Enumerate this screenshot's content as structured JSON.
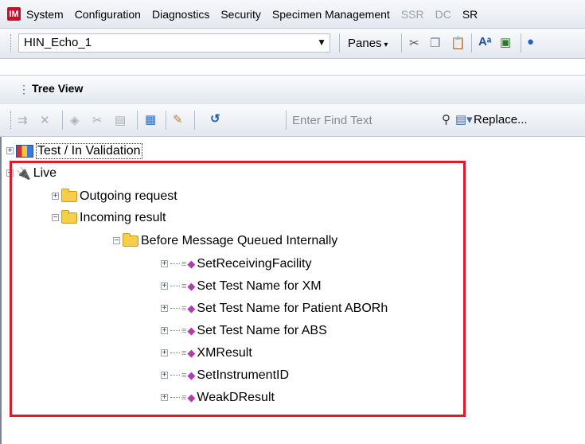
{
  "menu": {
    "logo": "IM",
    "items": [
      "System",
      "Configuration",
      "Diagnostics",
      "Security",
      "Specimen Management"
    ],
    "disabled_items": [
      "SSR",
      "DC"
    ],
    "trailing_item": "SR"
  },
  "toolbar": {
    "selector_value": "HIN_Echo_1",
    "panes_label": "Panes"
  },
  "tree_view": {
    "title": "Tree View"
  },
  "find_toolbar": {
    "find_placeholder": "Enter Find Text",
    "replace_label": "Replace..."
  },
  "tree": {
    "test_node": "Test / In Validation",
    "live_node": "Live",
    "outgoing": "Outgoing request",
    "incoming": "Incoming result",
    "before_queued": "Before Message Queued Internally",
    "rules": [
      "SetReceivingFacility",
      "Set Test Name for XM",
      "Set Test Name for Patient ABORh",
      "Set Test Name for ABS",
      "XMResult",
      "SetInstrumentID",
      "WeakDResult"
    ]
  },
  "colors": {
    "highlight_border": "#e0192b",
    "logo_red": "#c8102e"
  }
}
